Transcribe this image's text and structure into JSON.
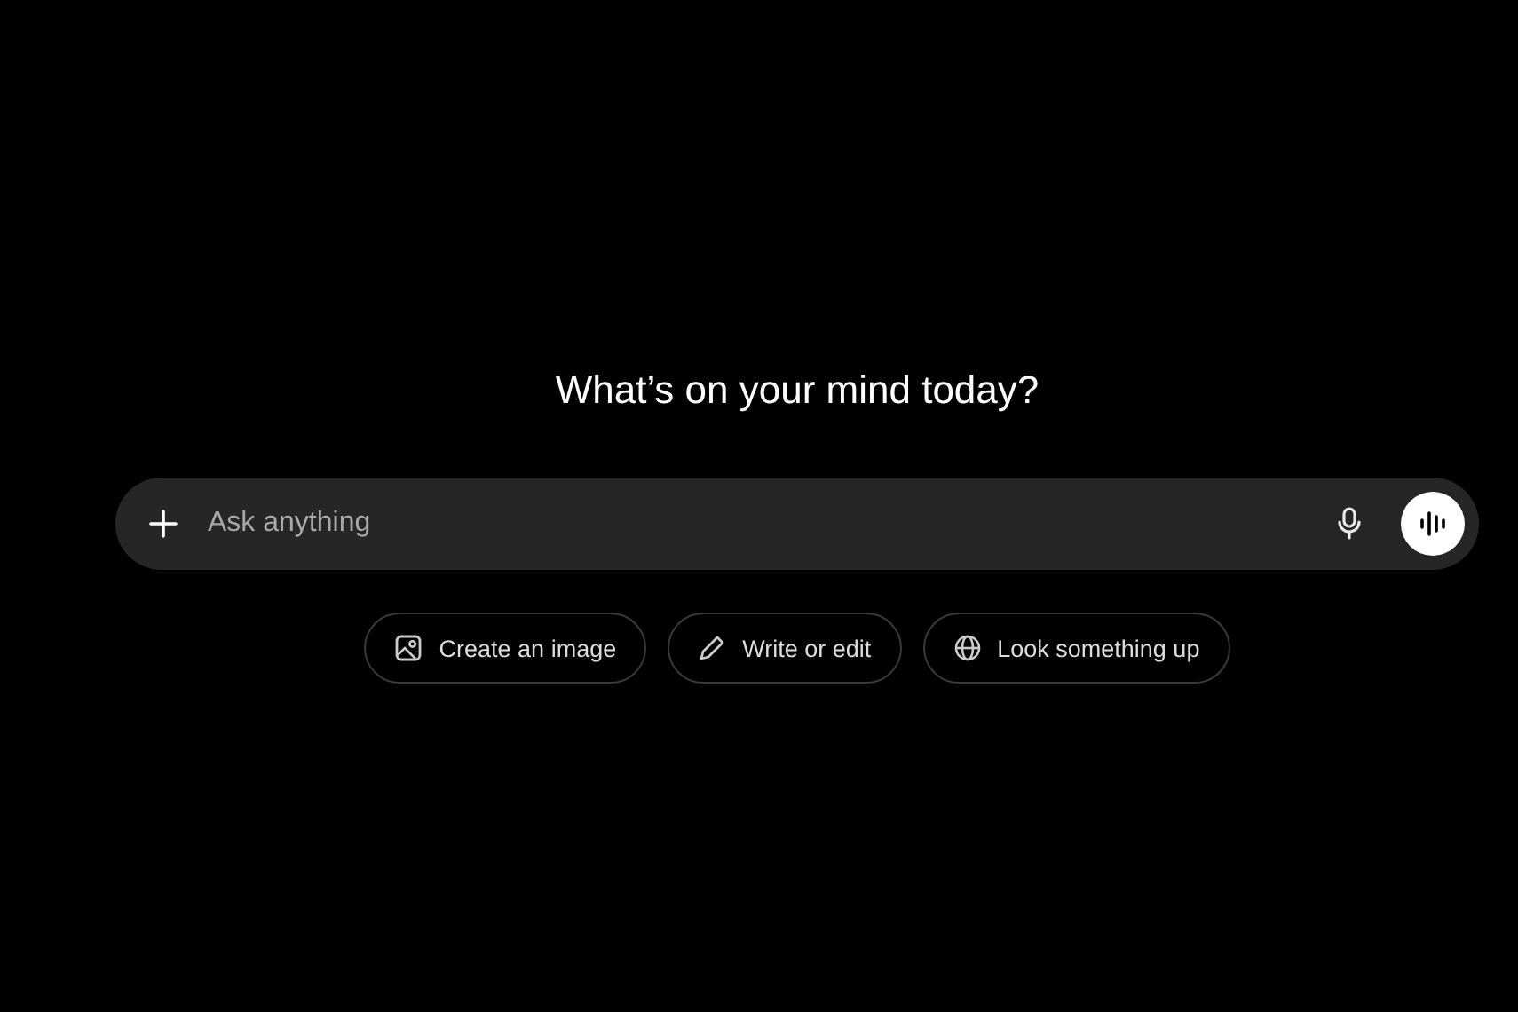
{
  "heading": "What’s on your mind today?",
  "composer": {
    "placeholder": "Ask anything"
  },
  "suggestions": [
    {
      "kind": "image",
      "label": "Create an image"
    },
    {
      "kind": "pencil",
      "label": "Write or edit"
    },
    {
      "kind": "globe",
      "label": "Look something up"
    }
  ]
}
